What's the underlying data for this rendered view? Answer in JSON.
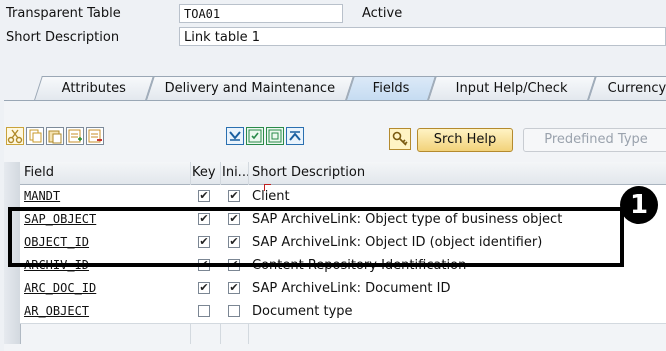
{
  "header": {
    "table_type_label": "Transparent Table",
    "table_name": "TOA01",
    "status": "Active",
    "short_desc_label": "Short Description",
    "short_desc_value": "Link table 1"
  },
  "tabs": [
    {
      "label": "Attributes",
      "active": false
    },
    {
      "label": "Delivery and Maintenance",
      "active": false
    },
    {
      "label": "Fields",
      "active": true
    },
    {
      "label": "Input Help/Check",
      "active": false
    },
    {
      "label": "Currency",
      "active": false
    }
  ],
  "toolbar": {
    "icons": [
      "cut-icon",
      "copy-icon",
      "paste-icon",
      "insert-row-icon",
      "delete-row-icon",
      "move-down-icon",
      "select-icon",
      "deselect-icon",
      "move-up-icon",
      "key-icon"
    ],
    "srch_help_label": "Srch Help",
    "predefined_type_label": "Predefined Type"
  },
  "grid": {
    "columns": {
      "field": "Field",
      "key": "Key",
      "ini": "Ini...",
      "desc": "Short Description"
    },
    "rows": [
      {
        "field": "MANDT",
        "key": true,
        "ini": true,
        "desc": "Client"
      },
      {
        "field": "SAP_OBJECT",
        "key": true,
        "ini": true,
        "desc": "SAP ArchiveLink: Object type of business object"
      },
      {
        "field": "OBJECT_ID",
        "key": true,
        "ini": true,
        "desc": "SAP ArchiveLink: Object ID (object identifier)"
      },
      {
        "field": "ARCHIV_ID",
        "key": true,
        "ini": true,
        "desc": "Content Repository Identification"
      },
      {
        "field": "ARC_DOC_ID",
        "key": true,
        "ini": true,
        "desc": "SAP ArchiveLink: Document ID"
      },
      {
        "field": "AR_OBJECT",
        "key": false,
        "ini": false,
        "desc": "Document type"
      }
    ]
  },
  "callout": {
    "number": "1"
  },
  "colors": {
    "accent": "#c6dcf2",
    "button": "#f2d27a",
    "highlight": "#000000"
  }
}
